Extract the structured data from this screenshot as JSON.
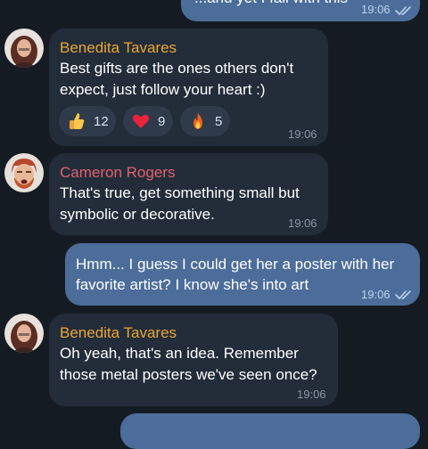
{
  "theme": {
    "background": "#151b23",
    "incoming_bubble": "#232c39",
    "outgoing_bubble": "#4c6d9a",
    "name_color_benedita": "#e8a736",
    "name_color_cameron": "#e0636b",
    "reaction_pill": "#2f3a4a"
  },
  "messages": [
    {
      "direction": "outgoing",
      "text": "...and yet I fall with this",
      "time": "19:06",
      "status_icon": "double-check-read-icon"
    },
    {
      "direction": "incoming",
      "sender": "Benedita Tavares",
      "avatar_icon": "benedita-avatar",
      "lines": [
        "Best gifts are the ones others don't",
        "expect, just follow your heart :)"
      ],
      "time": "19:06",
      "reactions": [
        {
          "emoji": "thumbs-up-icon",
          "count": "12"
        },
        {
          "emoji": "red-heart-icon",
          "count": "9"
        },
        {
          "emoji": "fire-icon",
          "count": "5"
        }
      ]
    },
    {
      "direction": "incoming",
      "sender": "Cameron Rogers",
      "avatar_icon": "cameron-avatar",
      "lines": [
        "That's true, get something small but",
        "symbolic or decorative."
      ],
      "time": "19:06"
    },
    {
      "direction": "outgoing",
      "lines": [
        "Hmm... I guess I could get her a poster with her",
        "favorite artist? I know she's into art"
      ],
      "time": "19:06",
      "status_icon": "double-check-read-icon"
    },
    {
      "direction": "incoming",
      "sender": "Benedita Tavares",
      "avatar_icon": "benedita-avatar",
      "lines": [
        "Oh yeah, that's an idea. Remember",
        "those metal posters we've seen once?"
      ],
      "time": "19:06"
    },
    {
      "direction": "outgoing",
      "text": "",
      "time": ""
    }
  ]
}
